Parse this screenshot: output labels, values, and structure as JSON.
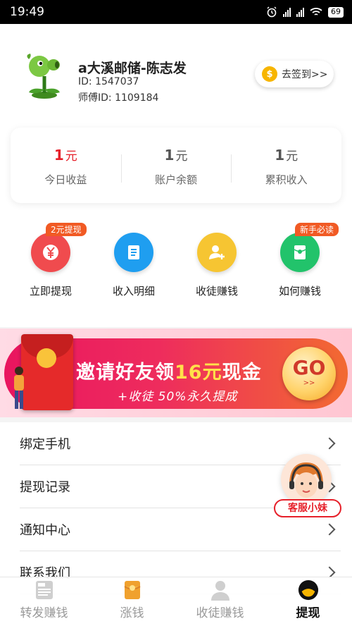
{
  "status_bar": {
    "time": "19:49",
    "battery": "69"
  },
  "profile": {
    "name": "a大溪邮储-陈志发",
    "id_line": "ID: 1547037",
    "master_line": "师傅ID: 1109184",
    "signin_label": "去签到>>",
    "signin_coin": "$"
  },
  "stats": [
    {
      "value": "1",
      "unit": "元",
      "label": "今日收益",
      "highlight": true
    },
    {
      "value": "1",
      "unit": "元",
      "label": "账户余额",
      "highlight": false
    },
    {
      "value": "1",
      "unit": "元",
      "label": "累积收入",
      "highlight": false
    }
  ],
  "actions": [
    {
      "label": "立即提现",
      "tag": "2元提现",
      "color": "#f04b4e",
      "icon": "yuan-icon"
    },
    {
      "label": "收入明细",
      "tag": "",
      "color": "#1f9ef0",
      "icon": "document-icon"
    },
    {
      "label": "收徒赚钱",
      "tag": "",
      "color": "#f6c532",
      "icon": "add-user-icon"
    },
    {
      "label": "如何赚钱",
      "tag": "新手必读",
      "color": "#22c36b",
      "icon": "red-packet-icon"
    }
  ],
  "banner": {
    "title_pre": "邀请好友领",
    "title_hl": "16元",
    "title_post": "现金",
    "subtitle": "+收徒 50%永久提成",
    "go_label": "GO",
    "go_arrows": ">>"
  },
  "menu": [
    {
      "label": "绑定手机"
    },
    {
      "label": "提现记录"
    },
    {
      "label": "通知中心"
    },
    {
      "label": "联系我们"
    }
  ],
  "support": {
    "label": "客服小妹"
  },
  "tabs": [
    {
      "label": "转发赚钱",
      "icon": "news-icon",
      "active": false
    },
    {
      "label": "涨钱",
      "icon": "red-envelope-icon",
      "active": false
    },
    {
      "label": "收徒赚钱",
      "icon": "user-icon",
      "active": false
    },
    {
      "label": "提现",
      "icon": "withdraw-icon",
      "active": true
    }
  ],
  "colors": {
    "accent_red": "#e6202a",
    "tag_orange": "#f15a24",
    "yellow": "#ffe14a"
  }
}
